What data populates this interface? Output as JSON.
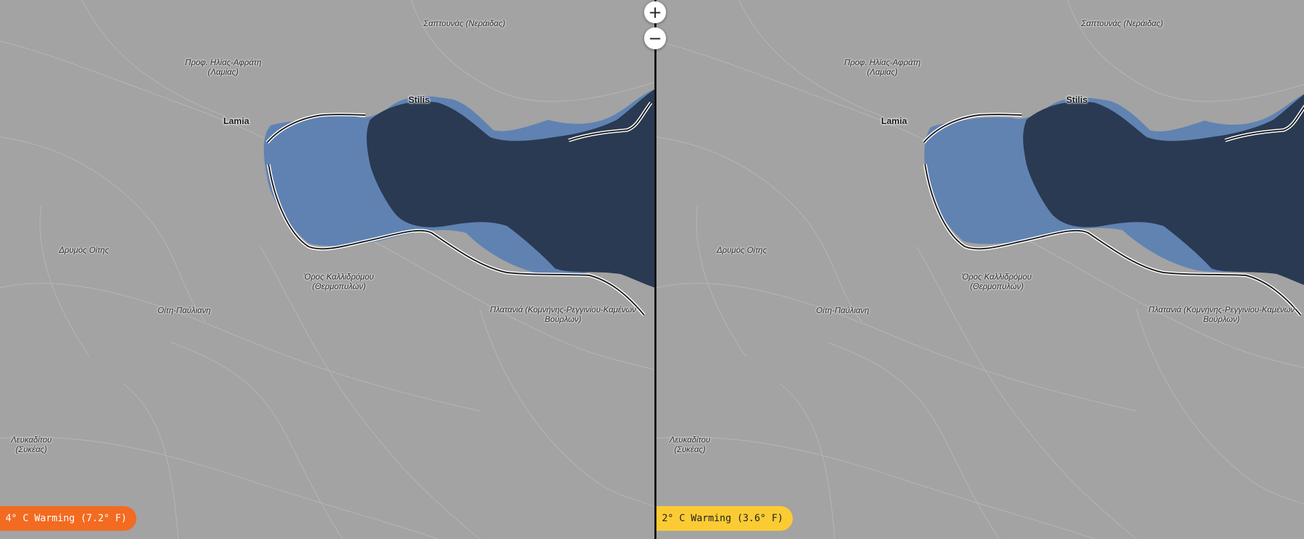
{
  "zoom": {
    "in_label": "+",
    "out_label": "−"
  },
  "left": {
    "badge": {
      "label": "4° C Warming (7.2° F)",
      "bg": "#f26b21",
      "color": "#ffffff"
    }
  },
  "right": {
    "badge": {
      "label": "2° C Warming (3.6° F)",
      "bg": "#fbcb34",
      "color": "#222222"
    }
  },
  "places": {
    "saptounas": "Σαπτουνάς (Νεράιδας)",
    "profilias_1": "Προφ. Ηλίας-Αφράτη",
    "profilias_2": "(Λαμίας)",
    "lamia": "Lamia",
    "stilis": "Stilis",
    "drymos": "Δρυμός Οίτης",
    "kallidromou_1": "Όρος Καλλιδρόμου",
    "kallidromou_2": "(Θερμοπυλών)",
    "oiti": "Οίτη-Παύλιανη",
    "platania_1": "Πλατανιά (Κομνήνης-Ρεγγινίου-Καμένων",
    "platania_2": "Βούρλων)",
    "lefkadition_1": "Λευκαδίτου",
    "lefkadition_2": "(Συκέας)"
  },
  "colors": {
    "land": "#a3a3a3",
    "sea": "#2a3a52",
    "flood": "#5a7fb4",
    "divider": "#111111"
  }
}
